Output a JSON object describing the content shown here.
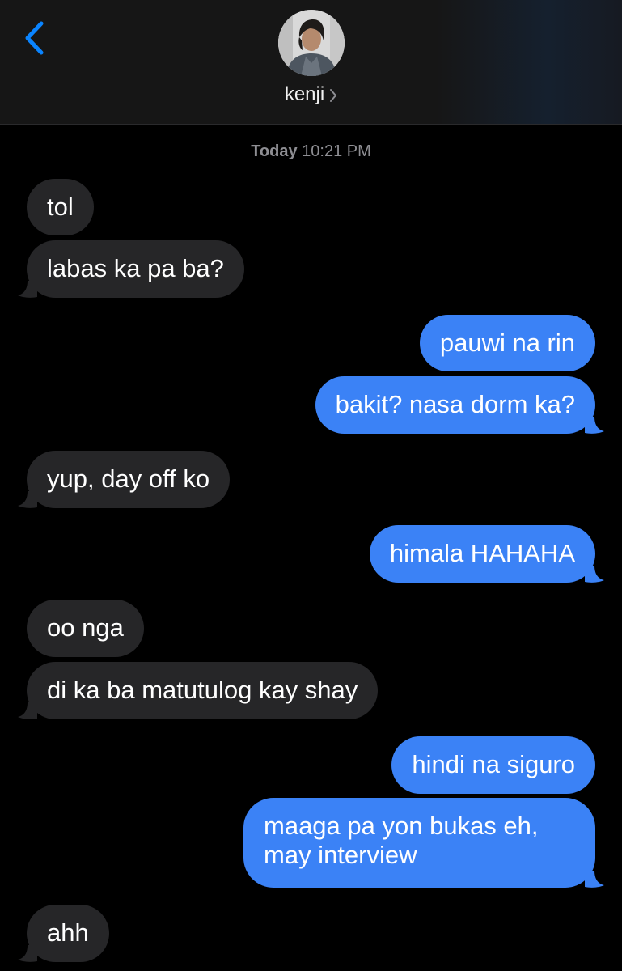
{
  "header": {
    "contact_name": "kenji",
    "back_icon": "chevron-left-icon",
    "avatar_icon": "contact-photo"
  },
  "colors": {
    "accent": "#0a84ff",
    "outgoing_bubble": "#3b82f6",
    "incoming_bubble": "#262628",
    "timestamp_text": "#8e8e93",
    "background": "#000000"
  },
  "timestamp": {
    "day": "Today",
    "time": "10:21 PM"
  },
  "messages": [
    {
      "direction": "incoming",
      "text": "tol"
    },
    {
      "direction": "incoming",
      "text": "labas ka pa ba?"
    },
    {
      "direction": "outgoing",
      "text": "pauwi na rin"
    },
    {
      "direction": "outgoing",
      "text": "bakit? nasa dorm ka?"
    },
    {
      "direction": "incoming",
      "text": "yup, day off ko"
    },
    {
      "direction": "outgoing",
      "text": "himala HAHAHA"
    },
    {
      "direction": "incoming",
      "text": "oo nga"
    },
    {
      "direction": "incoming",
      "text": "di ka ba matutulog kay shay"
    },
    {
      "direction": "outgoing",
      "text": "hindi na siguro"
    },
    {
      "direction": "outgoing",
      "text": "maaga pa yon bukas eh, may interview"
    },
    {
      "direction": "incoming",
      "text": "ahh"
    }
  ]
}
